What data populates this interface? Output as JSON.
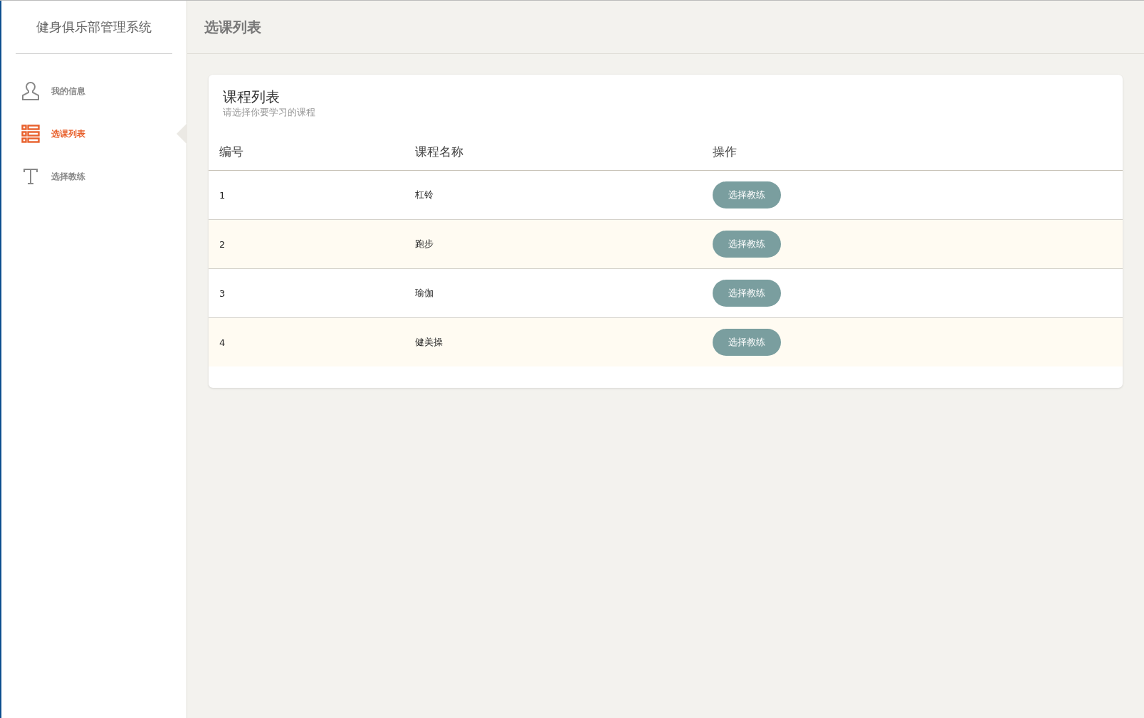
{
  "sidebar": {
    "title": "健身俱乐部管理系统",
    "items": [
      {
        "label": "我的信息",
        "kind": "person",
        "selected": false
      },
      {
        "label": "选课列表",
        "kind": "list",
        "selected": true
      },
      {
        "label": "选择教练",
        "kind": "text",
        "selected": false
      }
    ]
  },
  "header": {
    "title": "选课列表"
  },
  "card": {
    "title": "课程列表",
    "subtitle": "请选择你要学习的课程",
    "table": {
      "columns": [
        "编号",
        "课程名称",
        "操作"
      ],
      "rows": [
        {
          "id": "1",
          "name": "杠铃",
          "action": "选择教练"
        },
        {
          "id": "2",
          "name": "跑步",
          "action": "选择教练"
        },
        {
          "id": "3",
          "name": "瑜伽",
          "action": "选择教练"
        },
        {
          "id": "4",
          "name": "健美操",
          "action": "选择教练"
        }
      ]
    }
  }
}
